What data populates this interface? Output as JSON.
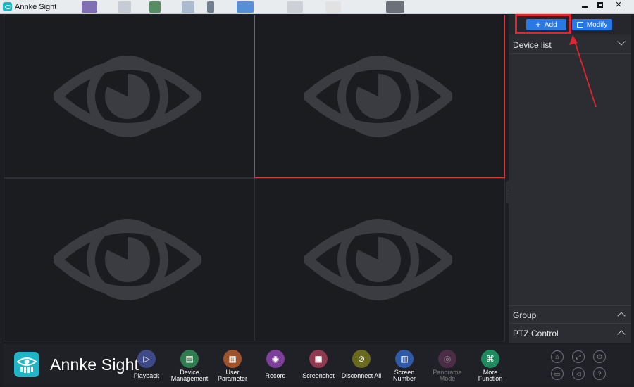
{
  "window": {
    "title": "Annke Sight"
  },
  "right_panel": {
    "add_label": "Add",
    "modify_label": "Modify",
    "device_list_label": "Device list",
    "group_label": "Group",
    "ptz_label": "PTZ Control"
  },
  "brand": {
    "name": "Annke Sight"
  },
  "toolbar": {
    "items": [
      {
        "label": "Playback",
        "color": "#3e4a87",
        "icon": "playback-icon"
      },
      {
        "label": "Device\nManagement",
        "color": "#2f7d4f",
        "icon": "device-management-icon"
      },
      {
        "label": "User\nParameter",
        "color": "#a0522d",
        "icon": "user-parameter-icon"
      },
      {
        "label": "Record",
        "color": "#7d3f9a",
        "icon": "record-icon"
      },
      {
        "label": "Screenshot",
        "color": "#8f3a4e",
        "icon": "screenshot-icon"
      },
      {
        "label": "Disconnect All",
        "color": "#6a6a1e",
        "icon": "disconnect-icon"
      },
      {
        "label": "Screen\nNumber",
        "color": "#2f5aa8",
        "icon": "screen-number-icon"
      },
      {
        "label": "Panorama\nMode",
        "color": "#7a3a68",
        "icon": "panorama-icon",
        "disabled": true
      },
      {
        "label": "More\nFunction",
        "color": "#1e8a5e",
        "icon": "more-function-icon"
      }
    ]
  },
  "colors": {
    "accent": "#2a78e4",
    "highlight": "#e2242e",
    "brand": "#1fb5c7"
  }
}
